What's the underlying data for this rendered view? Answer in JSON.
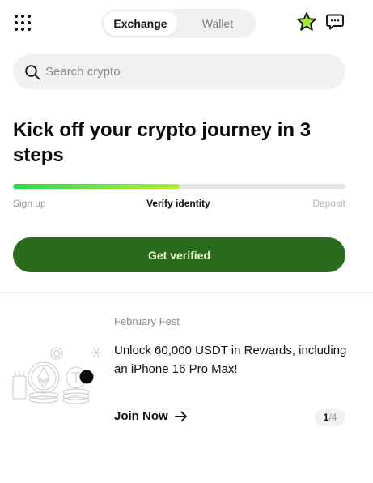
{
  "header": {
    "tabs": [
      {
        "label": "Exchange",
        "active": true
      },
      {
        "label": "Wallet",
        "active": false
      }
    ],
    "star_color": "#a4e637"
  },
  "search": {
    "placeholder": "Search crypto"
  },
  "onboarding": {
    "headline": "Kick off your crypto journey in 3 steps",
    "progress_fraction": 0.5,
    "steps": [
      "Sign up",
      "Verify identity",
      "Deposit"
    ],
    "cta_label": "Get verified",
    "cta_color": "#2b6b1d"
  },
  "promo": {
    "kicker": "February Fest",
    "title": "Unlock 60,000 USDT in Rewards, including an iPhone 16 Pro Max!",
    "link_label": "Join Now",
    "page_current": "1",
    "page_total": "/4"
  }
}
